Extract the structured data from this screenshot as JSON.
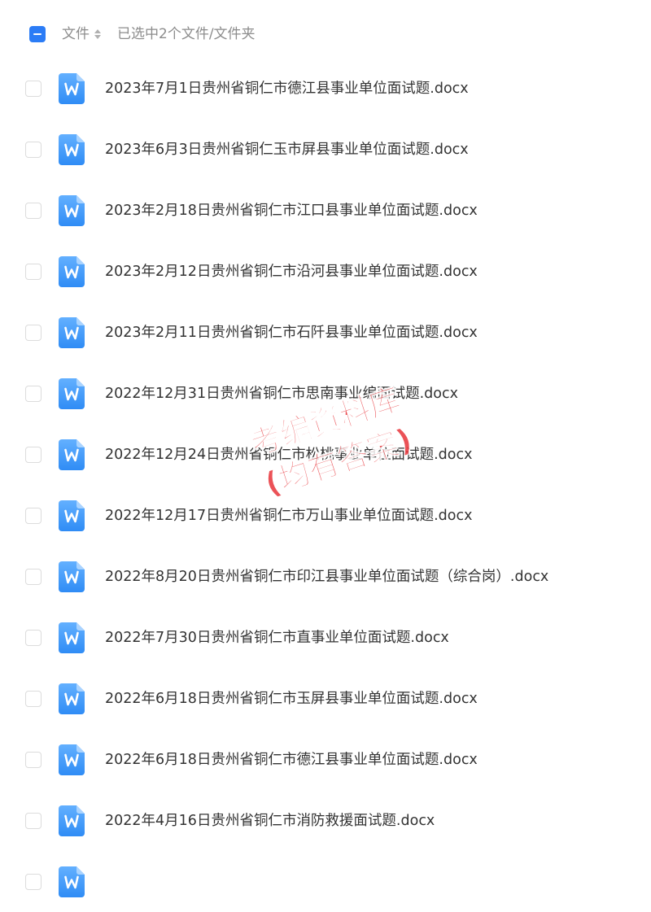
{
  "header": {
    "file_column_label": "文件",
    "selection_status": "已选中2个文件/文件夹"
  },
  "files": [
    {
      "name": "2023年7月1日贵州省铜仁市德江县事业单位面试题.docx"
    },
    {
      "name": "2023年6月3日贵州省铜仁玉市屏县事业单位面试题.docx"
    },
    {
      "name": "2023年2月18日贵州省铜仁市江口县事业单位面试题.docx"
    },
    {
      "name": "2023年2月12日贵州省铜仁市沿河县事业单位面试题.docx"
    },
    {
      "name": "2023年2月11日贵州省铜仁市石阡县事业单位面试题.docx"
    },
    {
      "name": "2022年12月31日贵州省铜仁市思南事业编面试题.docx"
    },
    {
      "name": "2022年12月24日贵州省铜仁市松桃事业单位面试题.docx"
    },
    {
      "name": "2022年12月17日贵州省铜仁市万山事业单位面试题.docx"
    },
    {
      "name": "2022年8月20日贵州省铜仁市印江县事业单位面试题（综合岗）.docx"
    },
    {
      "name": "2022年7月30日贵州省铜仁市直事业单位面试题.docx"
    },
    {
      "name": "2022年6月18日贵州省铜仁市玉屏县事业单位面试题.docx"
    },
    {
      "name": "2022年6月18日贵州省铜仁市德江县事业单位面试题.docx"
    },
    {
      "name": "2022年4月16日贵州省铜仁市消防救援面试题.docx"
    },
    {
      "name": ""
    }
  ],
  "watermark": {
    "line1": "考编資料库",
    "line2": "(均有答案)",
    "color": "#e8353a"
  },
  "colors": {
    "accent": "#2b7cf6",
    "word_icon_top": "#5aa9ff",
    "word_icon_bottom": "#2f8cf5"
  },
  "icons": {
    "file_type": "word-document-icon",
    "sort": "sort-icon"
  }
}
